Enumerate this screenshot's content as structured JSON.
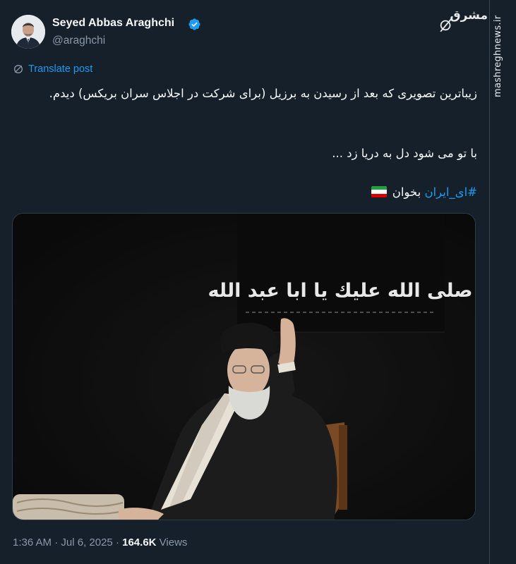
{
  "watermark": {
    "site": "mashreghnews.ir",
    "logo_text": "مشرق"
  },
  "author": {
    "name": "Seyed Abbas Araghchi",
    "handle": "@araghchi",
    "verified_color": "#1d9bf0"
  },
  "translate": {
    "label": "Translate post"
  },
  "tweet": {
    "line1": "زیباترین تصویری که بعد از رسیدن به برزیل (برای شرکت در اجلاس سران بریکس) دیدم.",
    "line2": "با تو می شود دل به دریا زد ...",
    "hashtag": "#ای_ایران",
    "after_hashtag": "بخوان"
  },
  "photo": {
    "banner_text": "صلى الله عليك يا ابا عبد الله"
  },
  "meta": {
    "time": "1:36 AM",
    "separator": "·",
    "date": "Jul 6, 2025",
    "views_count": "164.6K",
    "views_label": "Views"
  },
  "colors": {
    "background": "#15202b",
    "accent": "#1d9bf0",
    "muted": "#8b98a5"
  },
  "icons": [
    "grok-icon",
    "verified-badge-icon",
    "translate-icon",
    "iran-flag-icon"
  ]
}
